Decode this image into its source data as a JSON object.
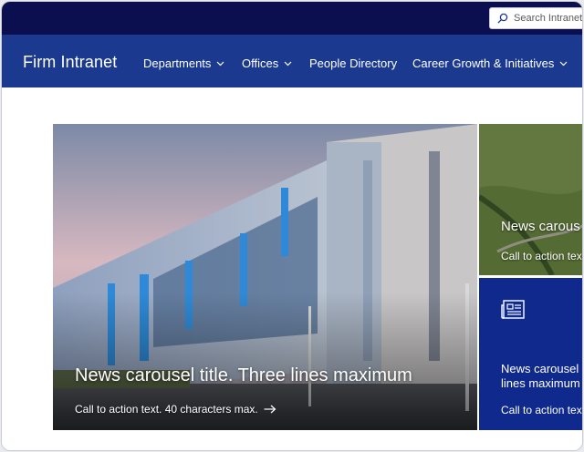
{
  "search": {
    "placeholder": "Search Intranet"
  },
  "brand": "Firm Intranet",
  "nav": [
    {
      "label": "Departments",
      "dropdown": true
    },
    {
      "label": "Offices",
      "dropdown": true
    },
    {
      "label": "People Directory",
      "dropdown": false
    },
    {
      "label": "Career Growth & Initiatives",
      "dropdown": true
    }
  ],
  "hero": {
    "title": "News carousel title. Three lines maximum",
    "cta": "Call to action text. 40 characters max."
  },
  "cards": [
    {
      "title": "News carous",
      "cta": "Call to action tex"
    },
    {
      "title_line1": "News carousel",
      "title_line2": "lines maximum",
      "cta": "Call to action tex",
      "icon": "newspaper-icon"
    }
  ],
  "colors": {
    "topbar": "#0b0f4f",
    "navbar": "#1b3a8f",
    "card_blue": "#0f2a8c"
  }
}
